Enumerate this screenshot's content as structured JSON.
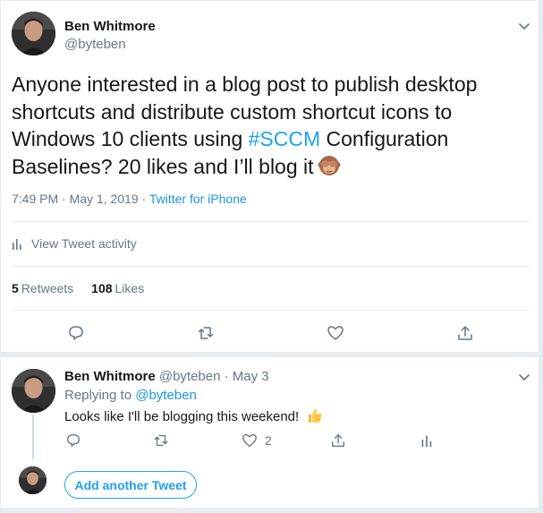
{
  "main_tweet": {
    "author_name": "Ben Whitmore",
    "author_handle": "@byteben",
    "text_before": "Anyone interested in a blog post to publish desktop shortcuts and distribute custom shortcut icons to Windows 10 clients using ",
    "hashtag": "#SCCM",
    "text_after": " Configuration Baselines? 20 likes and I’ll blog it",
    "emoji": "see-no-evil-monkey",
    "timestamp": "7:49 PM · May 1, 2019 · ",
    "source": "Twitter for iPhone",
    "activity_label": "View Tweet activity",
    "retweets_count": "5",
    "retweets_label": "Retweets",
    "likes_count": "108",
    "likes_label": "Likes",
    "icons": [
      "reply-icon",
      "retweet-icon",
      "like-icon",
      "share-icon",
      "chevron-down-icon",
      "analytics-icon"
    ]
  },
  "reply_tweet": {
    "author_name": "Ben Whitmore",
    "author_handle": "@byteben",
    "date": " · May 3",
    "replying_prefix": "Replying to ",
    "replying_to": "@byteben",
    "text": "Looks like I'll be blogging this weekend!",
    "emoji": "thumbs-up",
    "like_count": "2"
  },
  "composer": {
    "add_button_label": "Add another Tweet"
  },
  "colors": {
    "accent": "#1da1f2",
    "link": "#1b95e0",
    "muted": "#657786",
    "text": "#14171a",
    "divider": "#e6ecf0"
  }
}
